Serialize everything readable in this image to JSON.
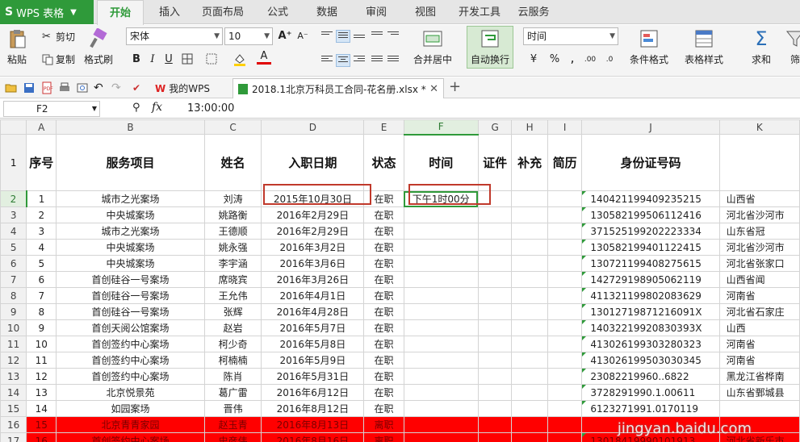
{
  "app": {
    "brand": "WPS 表格",
    "brand_color": "#2f9a3a"
  },
  "menu_tabs": [
    "开始",
    "插入",
    "页面布局",
    "公式",
    "数据",
    "审阅",
    "视图",
    "开发工具",
    "云服务"
  ],
  "ribbon": {
    "paste": "粘贴",
    "cut": "剪切",
    "copy": "复制",
    "format_painter": "格式刷",
    "font_name": "宋体",
    "font_size": "10",
    "merge_center": "合并居中",
    "wrap_text": "自动换行",
    "number_format": "时间",
    "percent": "%",
    "thousands": ",",
    "cond_format": "条件格式",
    "table_style": "表格样式",
    "sum": "求和",
    "filter": "筛"
  },
  "doc_tabs": {
    "home_tab": "我的WPS",
    "file_tab": "2018.1北京万科员工合同-花名册.xlsx *"
  },
  "formula_bar": {
    "cell_ref": "F2",
    "fx": "fx",
    "value": "13:00:00"
  },
  "columns": [
    "A",
    "B",
    "C",
    "D",
    "E",
    "F",
    "G",
    "H",
    "I",
    "J",
    "K"
  ],
  "header_row": {
    "num": "1",
    "cells": [
      "序号",
      "服务项目",
      "姓名",
      "入职日期",
      "状态",
      "时间",
      "证件",
      "补充",
      "简历",
      "身份证号码",
      ""
    ]
  },
  "rows": [
    {
      "num": "2",
      "a": "1",
      "b": "城市之光案场",
      "c": "刘涛",
      "d": "2015年10月30日",
      "e": "在职",
      "f": "下午1时00分",
      "j": "140421199409235215",
      "k": "山西省"
    },
    {
      "num": "3",
      "a": "2",
      "b": "中央城案场",
      "c": "姚路衡",
      "d": "2016年2月29日",
      "e": "在职",
      "f": "",
      "j": "130582199506112416",
      "k": "河北省沙河市"
    },
    {
      "num": "4",
      "a": "3",
      "b": "城市之光案场",
      "c": "王德顺",
      "d": "2016年2月29日",
      "e": "在职",
      "f": "",
      "j": "371525199202223334",
      "k": "山东省冠"
    },
    {
      "num": "5",
      "a": "4",
      "b": "中央城案场",
      "c": "姚永强",
      "d": "2016年3月2日",
      "e": "在职",
      "f": "",
      "j": "130582199401122415",
      "k": "河北省沙河市"
    },
    {
      "num": "6",
      "a": "5",
      "b": "中央城案场",
      "c": "李宇涵",
      "d": "2016年3月6日",
      "e": "在职",
      "f": "",
      "j": "130721199408275615",
      "k": "河北省张家口"
    },
    {
      "num": "7",
      "a": "6",
      "b": "首创硅谷一号案场",
      "c": "席晓宾",
      "d": "2016年3月26日",
      "e": "在职",
      "f": "",
      "j": "142729198905062119",
      "k": "山西省闻"
    },
    {
      "num": "8",
      "a": "7",
      "b": "首创硅谷一号案场",
      "c": "王允伟",
      "d": "2016年4月1日",
      "e": "在职",
      "f": "",
      "j": "411321199802083629",
      "k": "河南省"
    },
    {
      "num": "9",
      "a": "8",
      "b": "首创硅谷一号案场",
      "c": "张辉",
      "d": "2016年4月28日",
      "e": "在职",
      "f": "",
      "j": "13012719871216091X",
      "k": "河北省石家庄"
    },
    {
      "num": "10",
      "a": "9",
      "b": "首创天阅公馆案场",
      "c": "赵岩",
      "d": "2016年5月7日",
      "e": "在职",
      "f": "",
      "j": "14032219920830393X",
      "k": "山西"
    },
    {
      "num": "11",
      "a": "10",
      "b": "首创签约中心案场",
      "c": "柯少奇",
      "d": "2016年5月8日",
      "e": "在职",
      "f": "",
      "j": "413026199303280323",
      "k": "河南省"
    },
    {
      "num": "12",
      "a": "11",
      "b": "首创签约中心案场",
      "c": "柯楠楠",
      "d": "2016年5月9日",
      "e": "在职",
      "f": "",
      "j": "413026199503030345",
      "k": "河南省"
    },
    {
      "num": "13",
      "a": "12",
      "b": "首创签约中心案场",
      "c": "陈肖",
      "d": "2016年5月31日",
      "e": "在职",
      "f": "",
      "j": "23082219960..6822",
      "k": "黑龙江省桦南"
    },
    {
      "num": "14",
      "a": "13",
      "b": "北京悦景苑",
      "c": "葛广雷",
      "d": "2016年6月12日",
      "e": "在职",
      "f": "",
      "j": "3728291990.1.00611",
      "k": "山东省鄄城县"
    },
    {
      "num": "15",
      "a": "14",
      "b": "如园案场",
      "c": "晋伟",
      "d": "2016年8月12日",
      "e": "在职",
      "f": "",
      "j": "6123271991.0170119",
      "k": ""
    },
    {
      "num": "16",
      "a": "15",
      "b": "北京青青家园",
      "c": "赵玉青",
      "d": "2016年8月13日",
      "e": "离职",
      "f": "",
      "j": "",
      "k": "",
      "red": true
    },
    {
      "num": "17",
      "a": "16",
      "b": "首创签约中心案场",
      "c": "史彦伟",
      "d": "2016年8月16日",
      "e": "离职",
      "f": "",
      "j": "13018419990101913",
      "k": "河北省新乐市",
      "red": true
    }
  ],
  "watermark": "jingyan.baidu.com"
}
